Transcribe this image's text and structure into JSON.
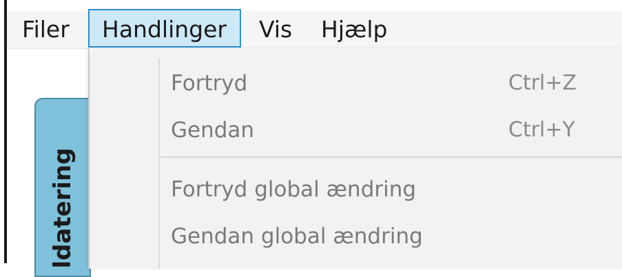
{
  "menubar": {
    "items": [
      {
        "label": "Filer"
      },
      {
        "label": "Handlinger"
      },
      {
        "label": "Vis"
      },
      {
        "label": "Hjælp"
      }
    ],
    "active": "Handlinger"
  },
  "side_tab": {
    "label": "ldatering"
  },
  "dropdown": {
    "items": [
      {
        "label": "Fortryd",
        "shortcut": "Ctrl+Z"
      },
      {
        "label": "Gendan",
        "shortcut": "Ctrl+Y"
      },
      {
        "label": "Fortryd global ændring"
      },
      {
        "label": "Gendan global ændring"
      }
    ]
  },
  "colors": {
    "active_menu_bg": "#cde8f6",
    "active_menu_border": "#2d8ed1",
    "disabled_text": "#7a7a7a",
    "tab_bg": "#7fc1da"
  }
}
